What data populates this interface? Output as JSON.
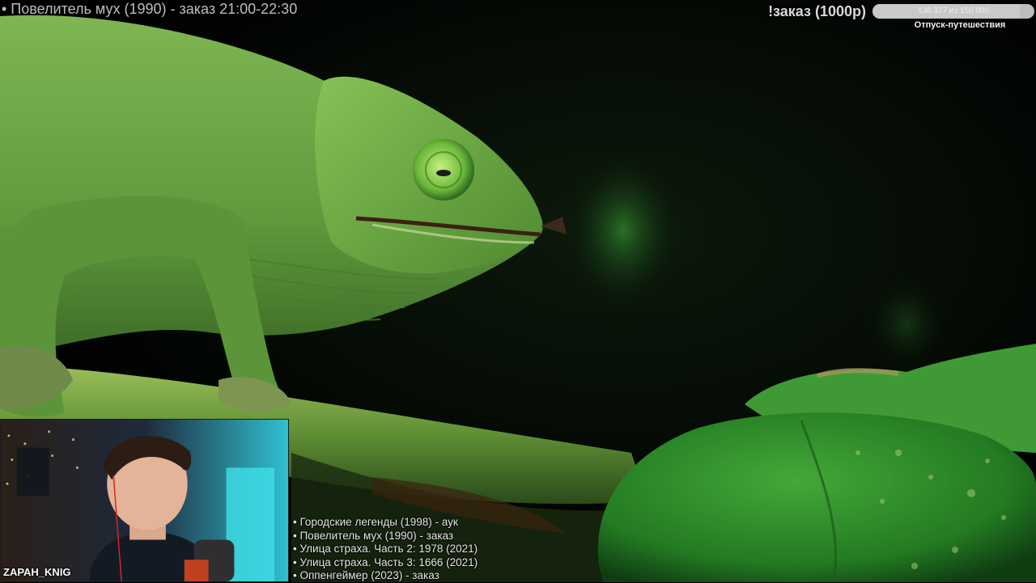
{
  "header": {
    "now_playing": "• Повелитель мух (1990) - заказ 21:00-22:30"
  },
  "goal": {
    "order_label": "!заказ (1000р)",
    "progress_text": "136 377 из 150 000",
    "progress_fraction": 0.909,
    "caption": "Отпуск-путешествия"
  },
  "webcam": {
    "streamer_name": "ZAPAH_KNIG"
  },
  "queue": {
    "items": [
      "• Городские легенды (1998) - аук",
      "• Повелитель мух (1990) - заказ",
      "• Улица страха. Часть 2: 1978 (2021)",
      "• Улица страха. Часть 3: 1666 (2021)",
      "• Оппенгеймер (2023) - заказ"
    ]
  },
  "colors": {
    "chameleon_green": "#6fae45",
    "leaf_green": "#2f8a2a",
    "background": "#000000"
  }
}
